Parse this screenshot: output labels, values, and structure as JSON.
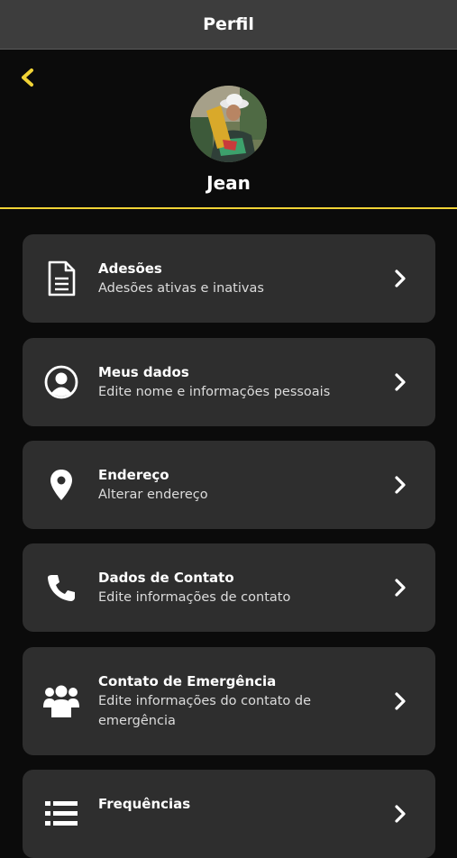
{
  "header": {
    "title": "Perfil",
    "user_name": "Jean"
  },
  "colors": {
    "accent": "#f1d336",
    "card_bg": "#2e2e2e",
    "topbar_bg": "#3d3d3d",
    "page_bg": "#0b0b0b"
  },
  "menu": {
    "items": [
      {
        "label": "Adesões",
        "sub": "Adesões ativas e inativas",
        "icon": "document-icon"
      },
      {
        "label": "Meus dados",
        "sub": "Edite nome e informações pessoais",
        "icon": "user-circle-icon"
      },
      {
        "label": "Endereço",
        "sub": "Alterar endereço",
        "icon": "map-pin-icon"
      },
      {
        "label": "Dados de Contato",
        "sub": "Edite informações de contato",
        "icon": "phone-icon"
      },
      {
        "label": "Contato de Emergência",
        "sub": "Edite informações do contato de emergência",
        "icon": "users-group-icon"
      },
      {
        "label": "Frequências",
        "sub": "",
        "icon": "list-icon"
      }
    ]
  }
}
